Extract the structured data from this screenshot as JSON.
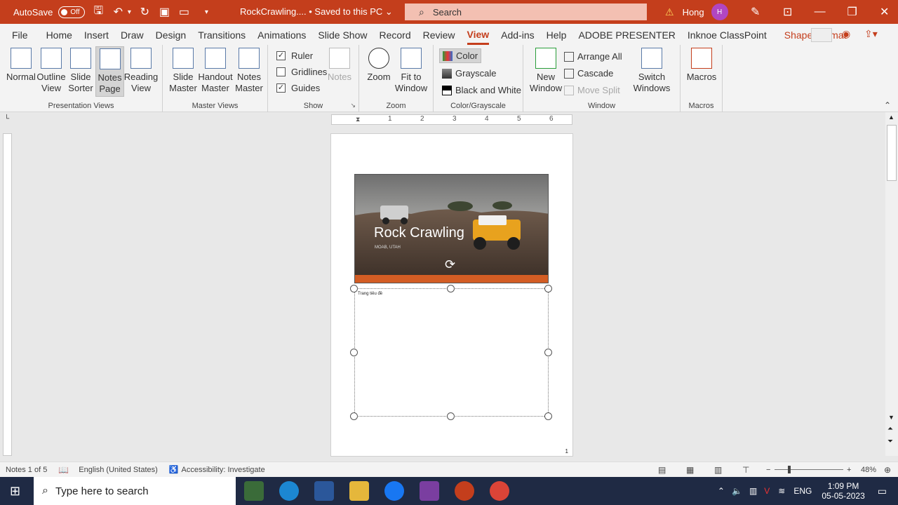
{
  "title_bar": {
    "autosave_label": "AutoSave",
    "autosave_state": "Off",
    "doc_name": "RockCrawling....",
    "save_status": "• Saved to this PC",
    "search_placeholder": "Search",
    "user_name": "Hong",
    "user_initial": "H"
  },
  "tabs": [
    "File",
    "Home",
    "Insert",
    "Draw",
    "Design",
    "Transitions",
    "Animations",
    "Slide Show",
    "Record",
    "Review",
    "View",
    "Add-ins",
    "Help",
    "ADOBE PRESENTER",
    "Inknoe ClassPoint",
    "Shape Format"
  ],
  "active_tab": "View",
  "ribbon": {
    "presentation_views": {
      "label": "Presentation Views",
      "normal": "Normal",
      "outline": "Outline View",
      "sorter": "Slide Sorter",
      "notes_page": "Notes Page",
      "reading": "Reading View"
    },
    "master_views": {
      "label": "Master Views",
      "slide_master": "Slide Master",
      "handout_master": "Handout Master",
      "notes_master": "Notes Master"
    },
    "show": {
      "label": "Show",
      "ruler": "Ruler",
      "gridlines": "Gridlines",
      "guides": "Guides",
      "notes": "Notes"
    },
    "zoom": {
      "label": "Zoom",
      "zoom": "Zoom",
      "fit": "Fit to Window"
    },
    "color": {
      "label": "Color/Grayscale",
      "color": "Color",
      "grayscale": "Grayscale",
      "bw": "Black and White"
    },
    "window": {
      "label": "Window",
      "new_window": "New Window",
      "arrange_all": "Arrange All",
      "cascade": "Cascade",
      "move_split": "Move Split",
      "switch": "Switch Windows"
    },
    "macros": {
      "label": "Macros",
      "macros": "Macros"
    }
  },
  "ruler_numbers": [
    "1",
    "2",
    "3",
    "4",
    "5",
    "6"
  ],
  "slide": {
    "title": "Rock Crawling",
    "subtitle": "MOAB, UTAH"
  },
  "notes_text": "Trang tiêu đề",
  "page_number": "1",
  "status": {
    "notes": "Notes 1 of 5",
    "language": "English (United States)",
    "accessibility": "Accessibility: Investigate",
    "zoom": "48%"
  },
  "taskbar": {
    "search": "Type here to search",
    "lang": "ENG",
    "time": "1:09 PM",
    "date": "05-05-2023"
  },
  "colors": {
    "accent": "#c43e1c"
  }
}
